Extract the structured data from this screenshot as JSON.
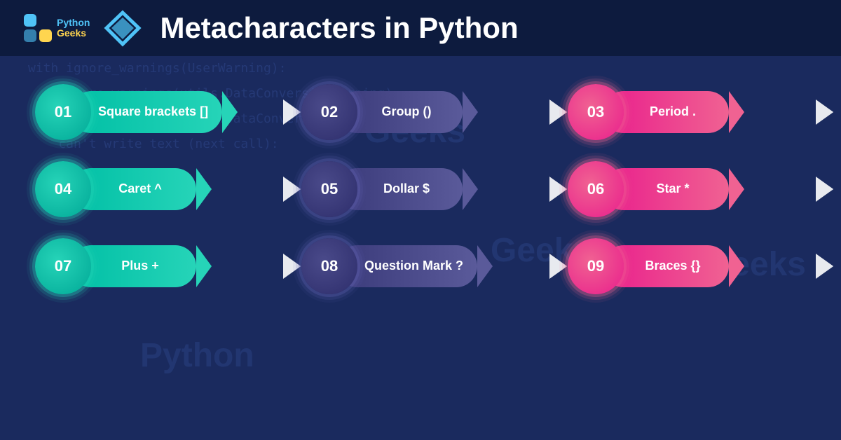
{
  "header": {
    "logo_python": "Python",
    "logo_geeks": "Geeks",
    "title": "Metacharacters in Python"
  },
  "bg_code_lines": [
    "with ignore_warnings(UserWarning):",
    "    ignore_warnings(utils.DataConversionWarning)",
    "    ignore_warnings(utils.DataConversionWarning)",
    "    can't write text (next call):"
  ],
  "watermarks": [
    "Geeks",
    "Geeks",
    "Python",
    "Geeks"
  ],
  "items": [
    {
      "id": "01",
      "label": "Square brackets []",
      "type": "teal"
    },
    {
      "id": "02",
      "label": "Group ()",
      "type": "dark"
    },
    {
      "id": "03",
      "label": "Period .",
      "type": "pink"
    },
    {
      "id": "04",
      "label": "Caret ^",
      "type": "teal"
    },
    {
      "id": "05",
      "label": "Dollar $",
      "type": "dark"
    },
    {
      "id": "06",
      "label": "Star *",
      "type": "pink"
    },
    {
      "id": "07",
      "label": "Plus +",
      "type": "teal"
    },
    {
      "id": "08",
      "label": "Question Mark ?",
      "type": "dark"
    },
    {
      "id": "09",
      "label": "Braces {}",
      "type": "pink"
    }
  ]
}
